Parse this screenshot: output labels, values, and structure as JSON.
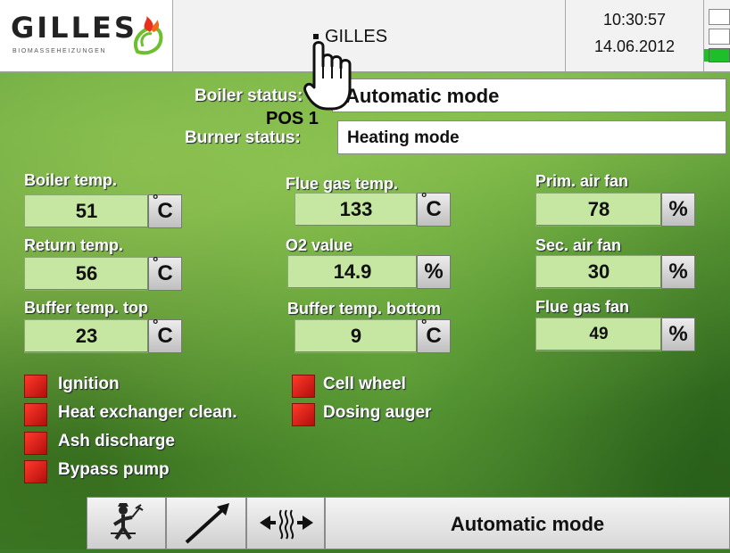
{
  "header": {
    "logo_text": "GILLES",
    "logo_subtitle": "BIOMASSEHEIZUNGEN",
    "title": "GILLES",
    "time": "10:30:57",
    "date": "14.06.2012"
  },
  "status": {
    "boiler_label": "Boiler status:",
    "boiler_value": "Automatic mode",
    "burner_label": "Burner status:",
    "burner_value": "Heating mode",
    "pos_label": "POS 1"
  },
  "measurements": {
    "boiler_temp": {
      "label": "Boiler temp.",
      "value": "51",
      "unit": "C"
    },
    "return_temp": {
      "label": "Return temp.",
      "value": "56",
      "unit": "C"
    },
    "buffer_top": {
      "label": "Buffer temp. top",
      "value": "23",
      "unit": "C"
    },
    "flue_gas_temp": {
      "label": "Flue gas temp.",
      "value": "133",
      "unit": "C"
    },
    "o2_value": {
      "label": "O2 value",
      "value": "14.9",
      "unit": "%"
    },
    "buffer_bottom": {
      "label": "Buffer temp. bottom",
      "value": "9",
      "unit": "C"
    },
    "prim_air_fan": {
      "label": "Prim. air fan",
      "value": "78",
      "unit": "%"
    },
    "sec_air_fan": {
      "label": "Sec. air fan",
      "value": "30",
      "unit": "%"
    },
    "flue_gas_fan": {
      "label": "Flue gas fan",
      "value": "49",
      "unit": "%"
    }
  },
  "indicators": {
    "ignition": "Ignition",
    "heat_exchanger": "Heat exchanger clean.",
    "ash_discharge": "Ash discharge",
    "bypass_pump": "Bypass pump",
    "cell_wheel": "Cell wheel",
    "dosing_auger": "Dosing auger"
  },
  "bottom_bar": {
    "mode": "Automatic mode"
  },
  "colors": {
    "indicator_off": "#d41a12",
    "value_field": "#c6e7a2",
    "status_green": "#1fbf2a"
  },
  "icons": [
    "chimney-sweep-icon",
    "arrow-up-right-icon",
    "heat-exchange-icon",
    "hand-pointer-icon"
  ]
}
